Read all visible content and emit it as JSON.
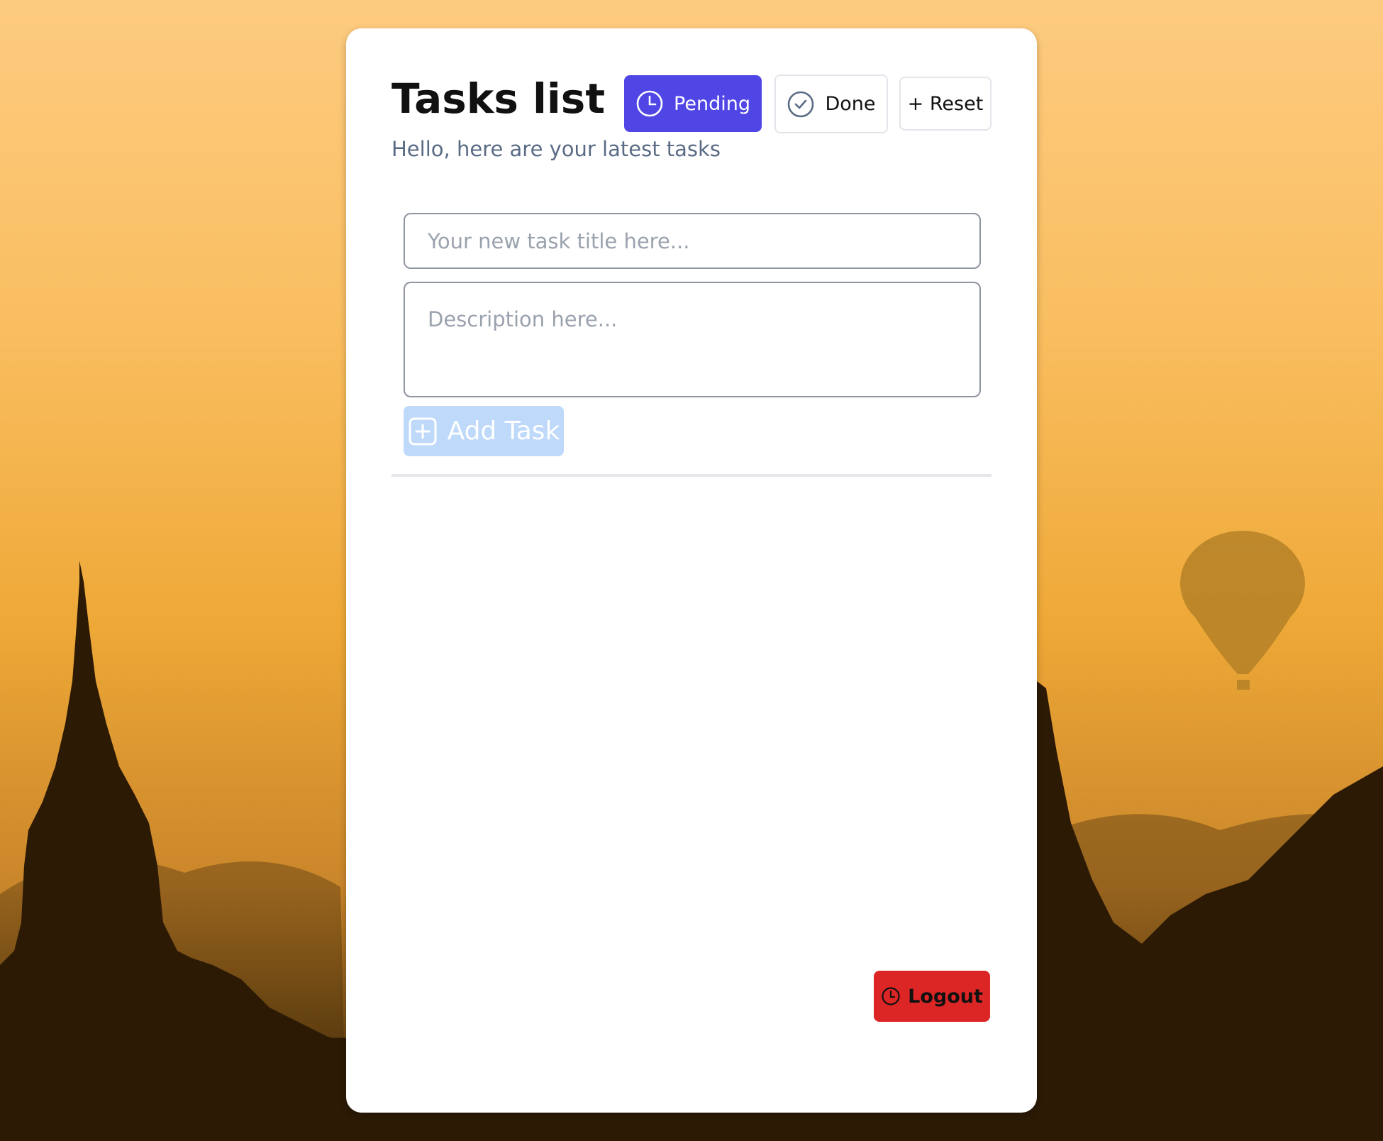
{
  "app": {
    "title": "Tasks list",
    "subtitle": "Hello, here are your latest tasks"
  },
  "filters": {
    "pending_label": "Pending",
    "done_label": "Done",
    "reset_label": "+ Reset",
    "active": "pending"
  },
  "form": {
    "title_placeholder": "Your new task title here...",
    "title_value": "",
    "description_placeholder": "Description here...",
    "description_value": "",
    "add_label": "Add Task"
  },
  "footer": {
    "logout_label": "Logout"
  },
  "colors": {
    "accent": "#4f46e5",
    "add_button": "#bfd9fb",
    "logout": "#dc2626",
    "subtitle": "#5a6b85"
  },
  "icons": {
    "pending": "clock-icon",
    "done": "check-circle-icon",
    "add": "plus-square-icon",
    "logout": "clock-icon"
  }
}
